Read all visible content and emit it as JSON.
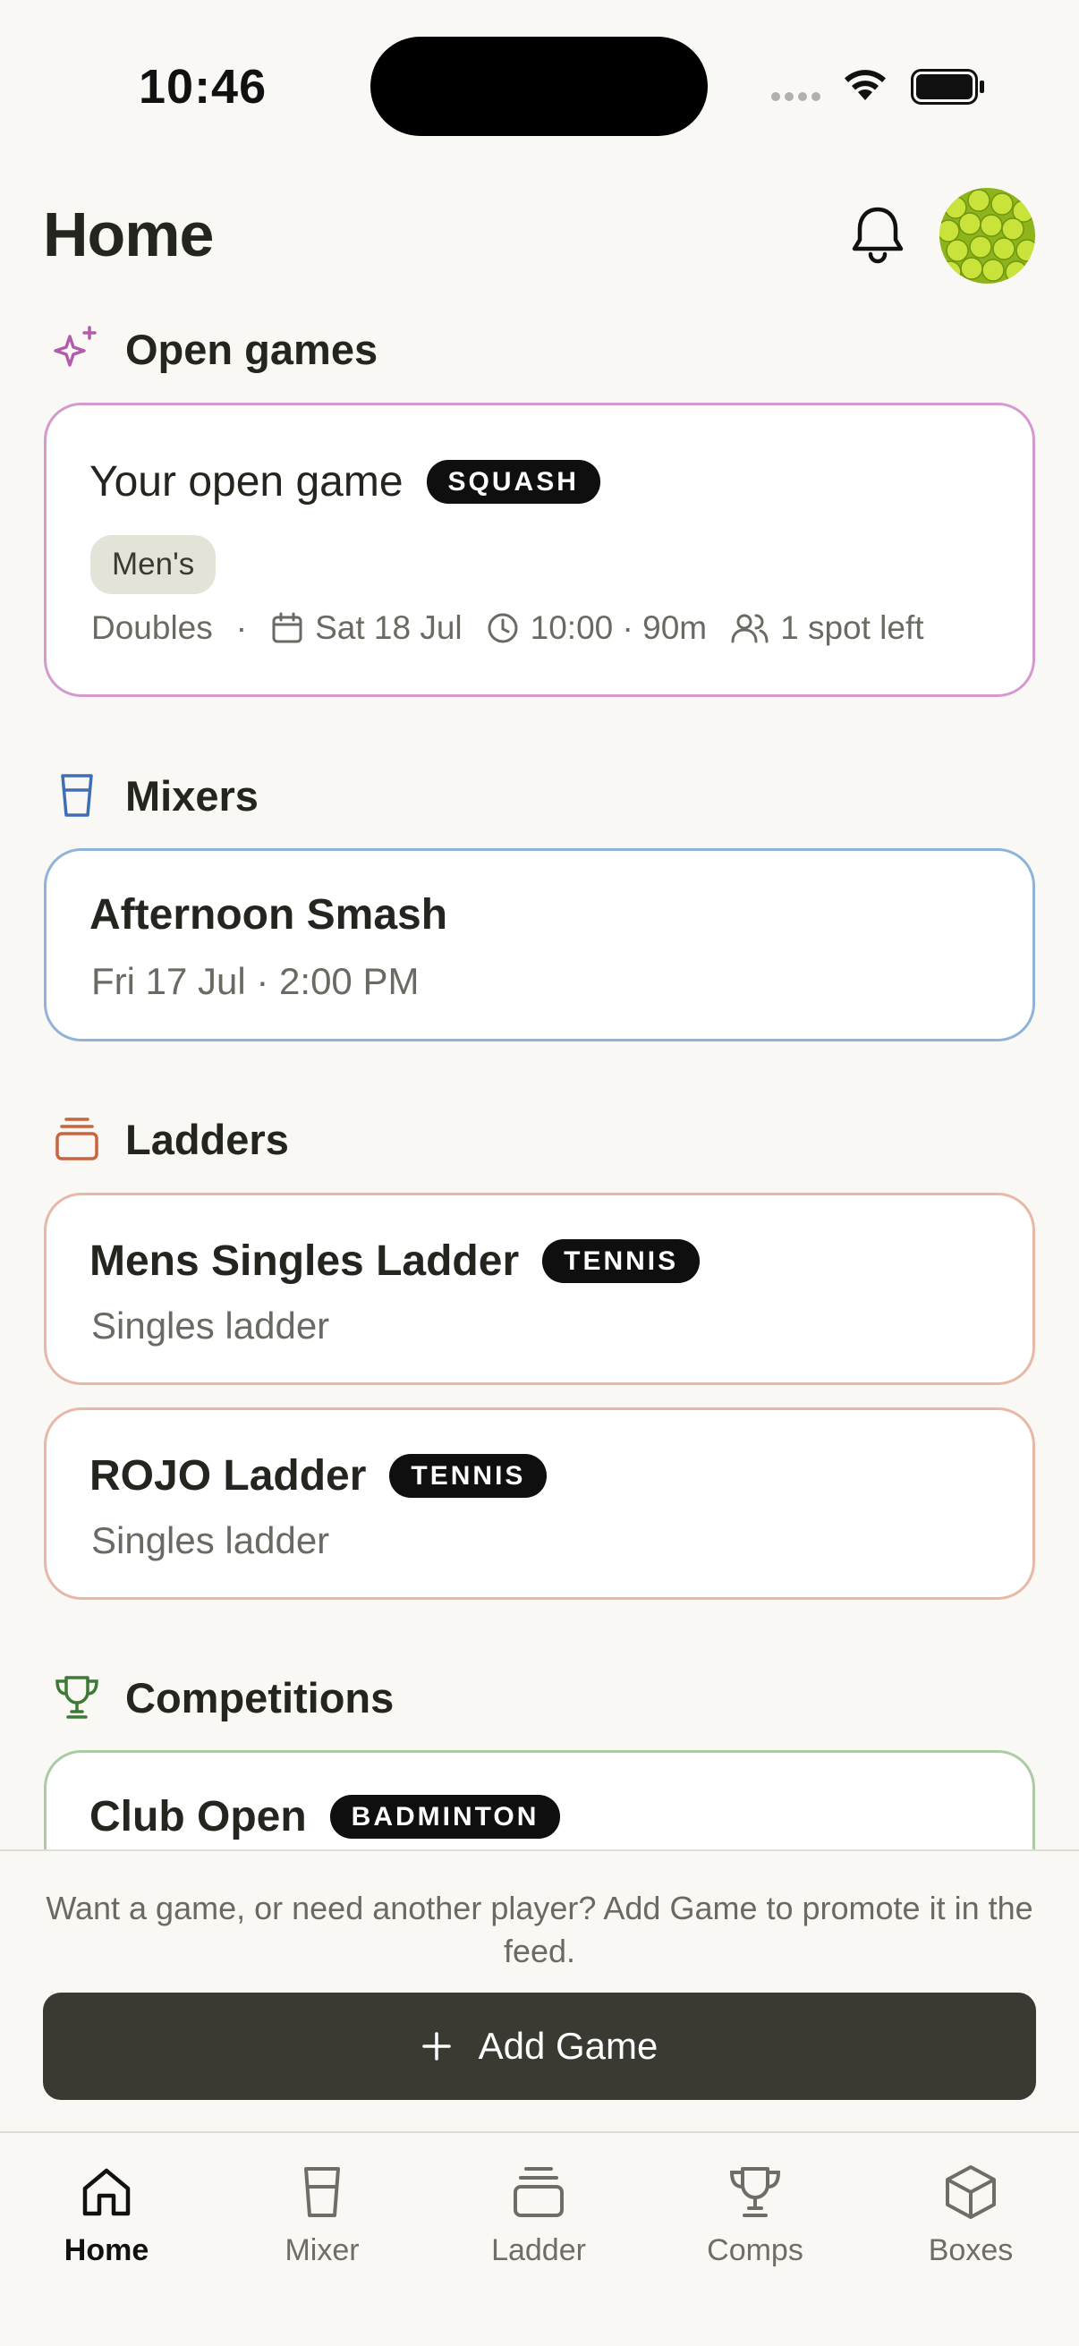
{
  "status_bar": {
    "time": "10:46"
  },
  "header": {
    "title": "Home"
  },
  "sections": {
    "open_games": {
      "title": "Open games",
      "card": {
        "title": "Your open game",
        "badge": "SQUASH",
        "chip": "Men's",
        "format": "Doubles",
        "separator": "·",
        "date": "Sat 18 Jul",
        "time": "10:00 · 90m",
        "spots": "1 spot left"
      }
    },
    "mixers": {
      "title": "Mixers",
      "card": {
        "title": "Afternoon Smash",
        "subtitle": "Fri 17 Jul · 2:00 PM"
      }
    },
    "ladders": {
      "title": "Ladders",
      "items": [
        {
          "title": "Mens Singles Ladder",
          "badge": "TENNIS",
          "subtitle": "Singles ladder"
        },
        {
          "title": "ROJO Ladder",
          "badge": "TENNIS",
          "subtitle": "Singles ladder"
        }
      ]
    },
    "competitions": {
      "title": "Competitions",
      "card": {
        "title": "Club Open",
        "badge": "BADMINTON"
      }
    }
  },
  "promo": {
    "text": "Want a game, or need another player? Add Game to promote it in the feed.",
    "button_label": "Add Game"
  },
  "tabs": [
    {
      "label": "Home",
      "icon": "home-icon",
      "active": true
    },
    {
      "label": "Mixer",
      "icon": "cup-icon",
      "active": false
    },
    {
      "label": "Ladder",
      "icon": "stack-icon",
      "active": false
    },
    {
      "label": "Comps",
      "icon": "trophy-icon",
      "active": false
    },
    {
      "label": "Boxes",
      "icon": "box-icon",
      "active": false
    }
  ],
  "colors": {
    "open_games_accent": "#c98cc7",
    "mixers_accent": "#8ab0d8",
    "ladders_accent": "#e6b4a2",
    "competitions_accent": "#a9c9a1",
    "button_bg": "#3a3a33"
  }
}
